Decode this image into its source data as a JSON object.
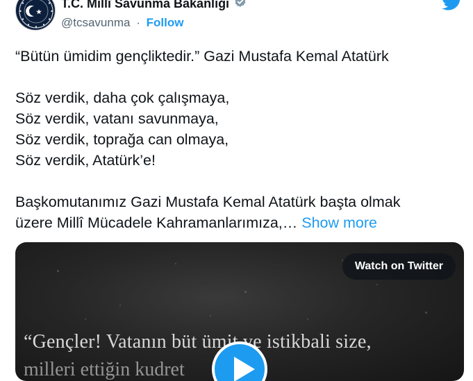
{
  "author": {
    "name": "T.C. Millî Savunma Bakanlığı",
    "handle": "@tcsavunma",
    "separator": "·",
    "follow_label": "Follow"
  },
  "icons": {
    "verified": "verified-badge-icon",
    "brand": "twitter-bird-icon",
    "play": "play-icon"
  },
  "colors": {
    "accent": "#1d9bf0",
    "text": "#0f1419",
    "muted": "#536471"
  },
  "tweet": {
    "quote_line": "“Bütün ümidim gençliktedir.” Gazi Mustafa Kemal Atatürk",
    "lines": [
      "Söz verdik, daha çok çalışmaya,",
      "Söz verdik, vatanı savunmaya,",
      "Söz verdik, toprağa can olmaya,",
      "Söz verdik, Atatürk’e!"
    ],
    "paragraph_line1": "Başkomutanımız Gazi Mustafa Kemal Atatürk başta olmak",
    "paragraph_line2": "üzere Millî Mücadele Kahramanlarımıza,…",
    "show_more_label": "Show more"
  },
  "media": {
    "watch_label": "Watch on Twitter",
    "video_text_line1": "“Gençler! Vatanın büt   ümit ve istikbali size,",
    "video_text_line2": "    milleri               ettiğin   kudret"
  }
}
